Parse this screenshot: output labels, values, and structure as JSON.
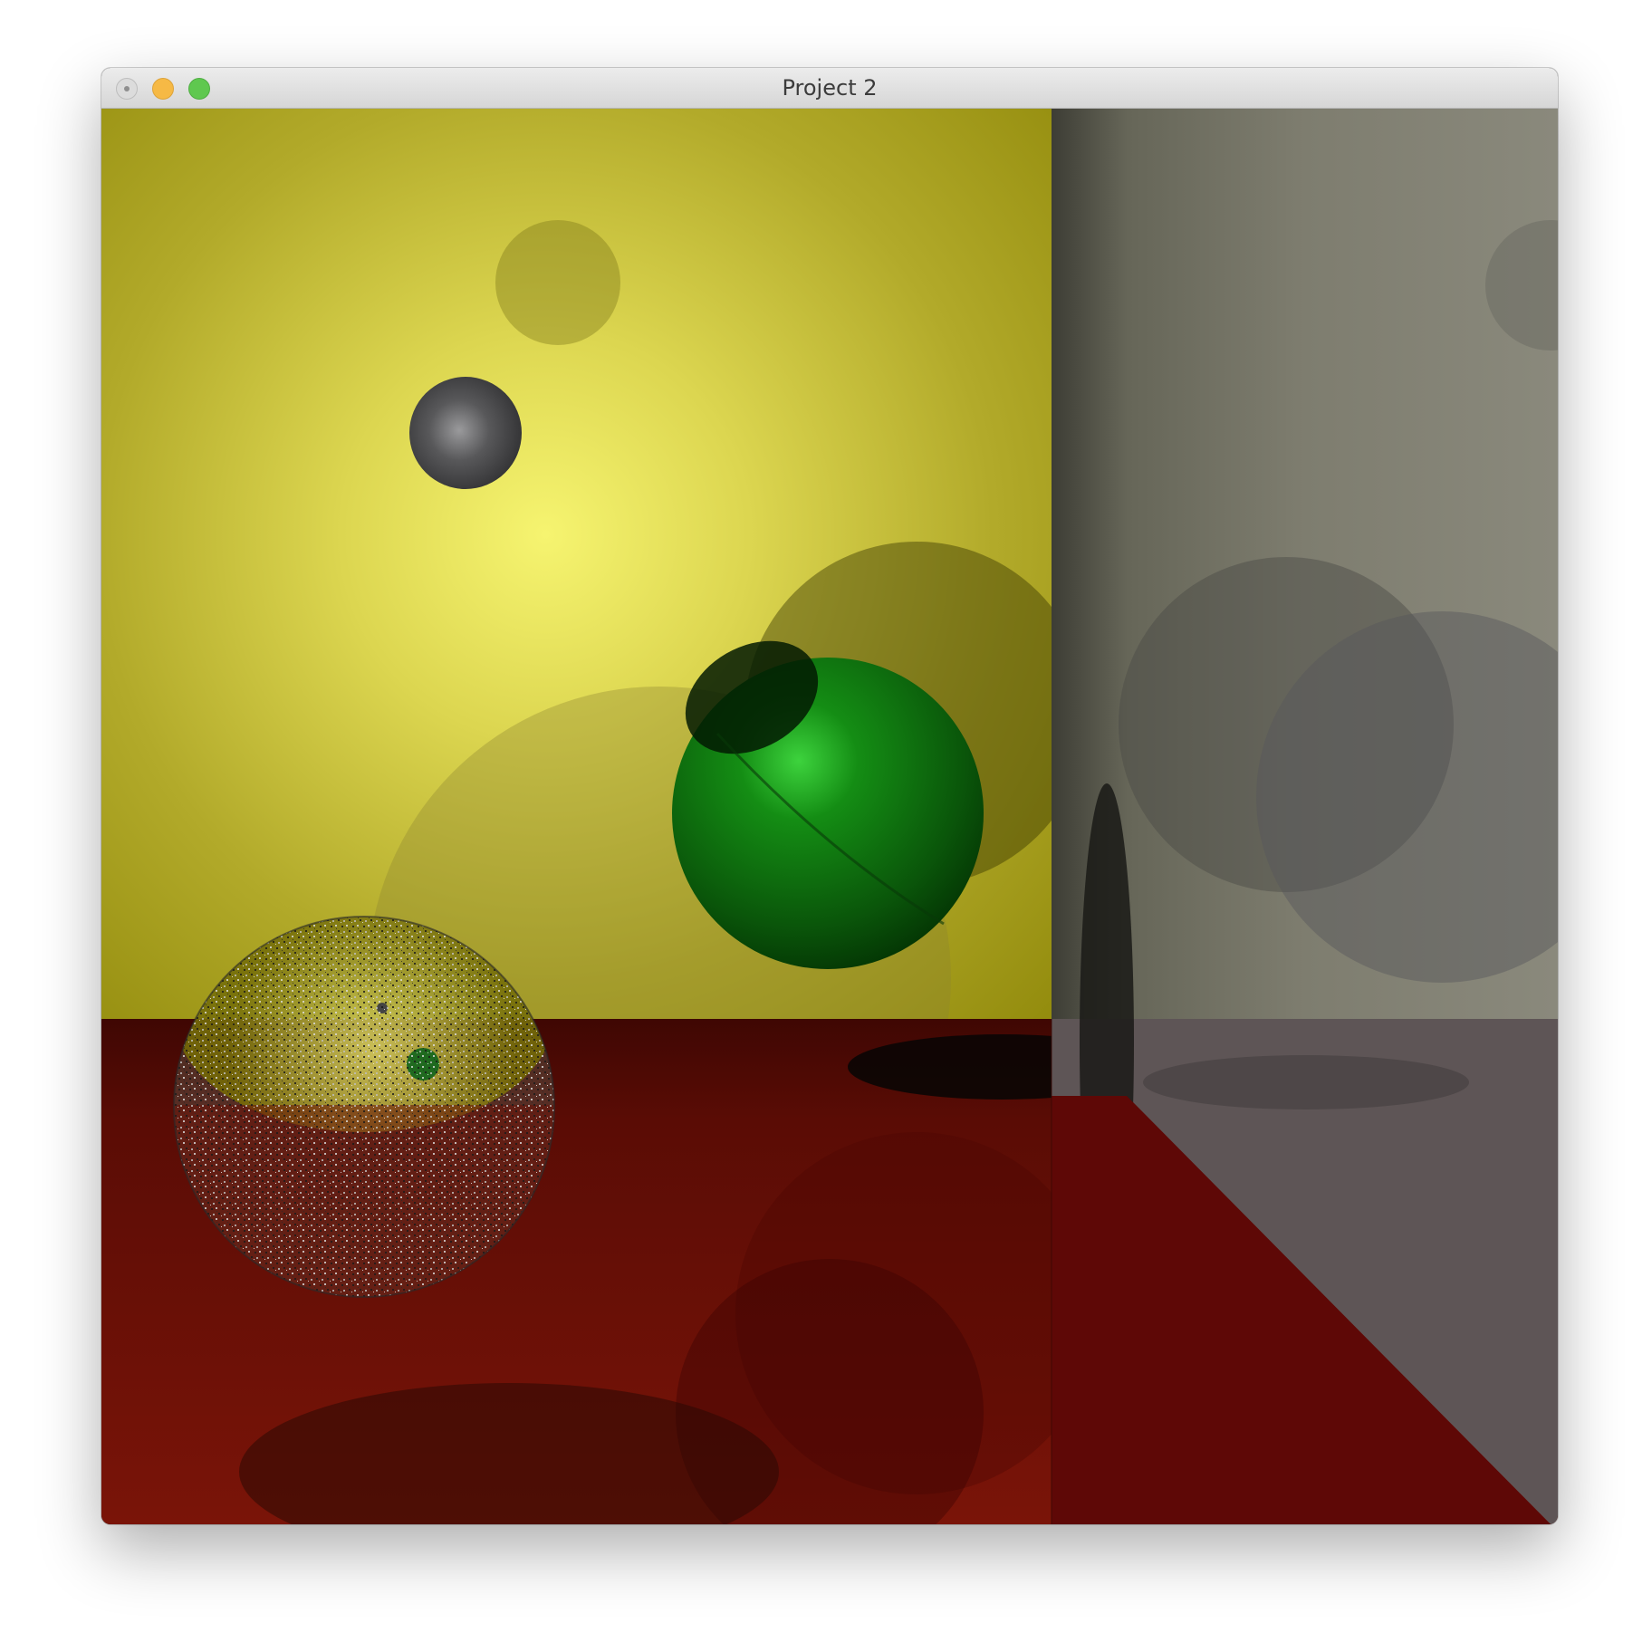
{
  "window": {
    "title": "Project 2",
    "buttons": {
      "close": "close-button",
      "minimize": "minimize-button",
      "zoom": "zoom-button"
    }
  },
  "scene": {
    "colors": {
      "back_wall_bright": "#f4f26e",
      "back_wall_dark": "#8a8200",
      "floor": "#6e1208",
      "side_wall": "#8a897a",
      "green_sphere": "#0a7a0a",
      "gray_sphere": "#4a4a4c"
    }
  }
}
